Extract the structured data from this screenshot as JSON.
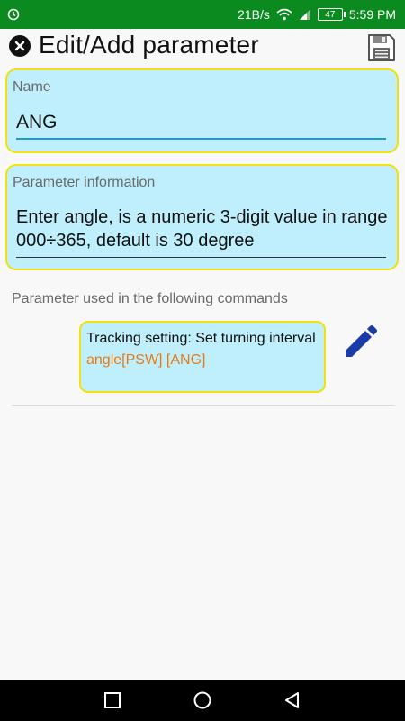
{
  "status_bar": {
    "network_speed": "21B/s",
    "battery_level": "47",
    "time": "5:59 PM",
    "color": "#0b8a20"
  },
  "header": {
    "title": "Edit/Add parameter",
    "close_icon": "close-circle-icon",
    "save_icon": "floppy-disk-icon"
  },
  "fields": {
    "name": {
      "label": "Name",
      "value": "ANG"
    },
    "info": {
      "label": "Parameter information",
      "value": "Enter angle, is a numeric 3-digit value in range 000÷365, default is 30 degree"
    }
  },
  "commands": {
    "section_label": "Parameter used in the following commands",
    "items": [
      {
        "title": "Tracking setting: Set turning interval",
        "syntax": "angle[PSW] [ANG]",
        "action_icon": "pencil-icon"
      }
    ]
  },
  "colors": {
    "card_bg": "#bfeffc",
    "card_border": "#f2e10a",
    "syntax_text": "#e87a12",
    "edit_icon": "#1a3aa8"
  },
  "nav_bar": {
    "icons": [
      "recent-apps-icon",
      "home-icon",
      "back-icon"
    ]
  }
}
